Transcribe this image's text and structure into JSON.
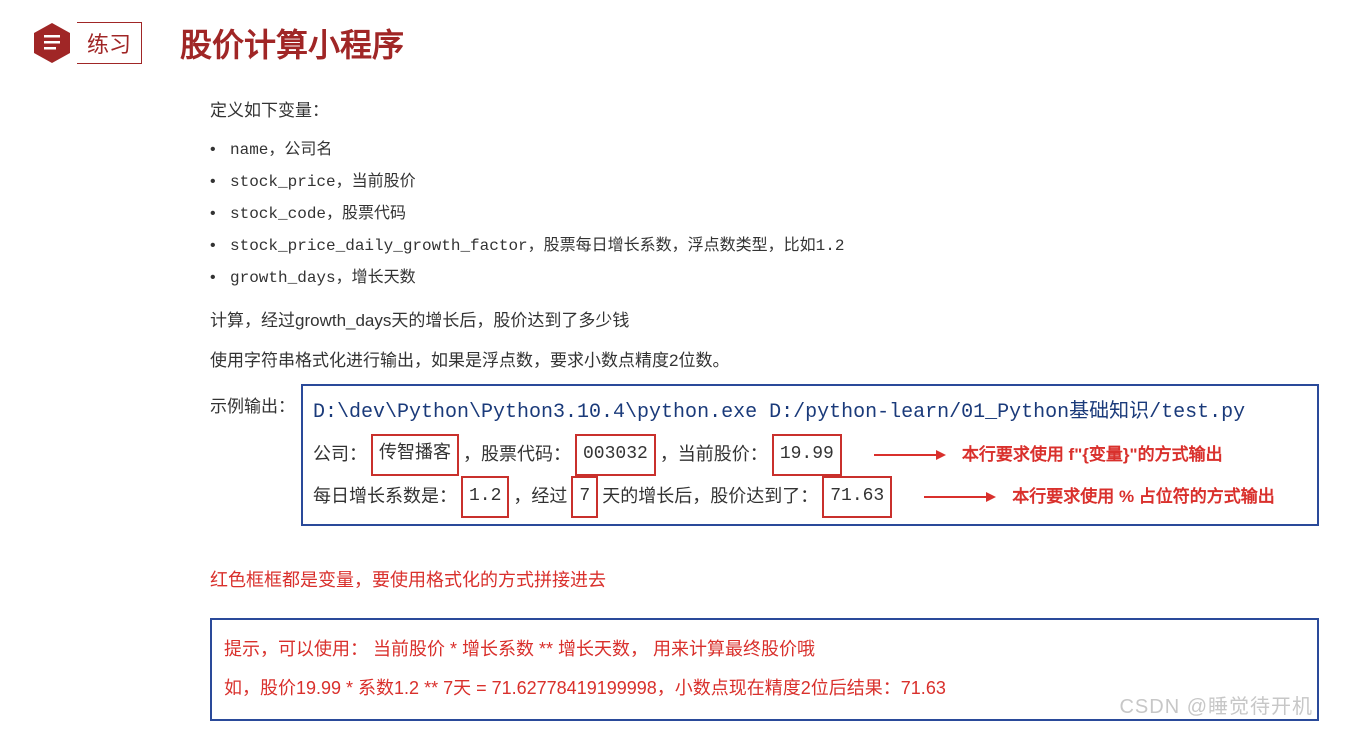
{
  "badge": {
    "label": "练习"
  },
  "title": "股价计算小程序",
  "intro": "定义如下变量：",
  "vars": [
    "name，公司名",
    "stock_price，当前股价",
    "stock_code，股票代码",
    "stock_price_daily_growth_factor，股票每日增长系数，浮点数类型，比如1.2",
    "growth_days，增长天数"
  ],
  "calc_line": "计算，经过growth_days天的增长后，股价达到了多少钱",
  "format_line": "使用字符串格式化进行输出，如果是浮点数，要求小数点精度2位数。",
  "example_label": "示例输出：",
  "output": {
    "path": "D:\\dev\\Python\\Python3.10.4\\python.exe D:/python-learn/01_Python基础知识/test.py",
    "line2": {
      "pre1": "公司：",
      "company": "传智播客",
      "mid1": "，股票代码：",
      "code": "003032",
      "mid2": "，当前股价：",
      "price": "19.99",
      "anno": "本行要求使用 f\"{变量}\"的方式输出"
    },
    "line3": {
      "pre1": "每日增长系数是：",
      "factor": "1.2",
      "mid1": "，经过",
      "days": "7",
      "mid2": "天的增长后，股价达到了：",
      "final": "71.63",
      "anno": "本行要求使用 % 占位符的方式输出"
    }
  },
  "red_note": "红色框框都是变量，要使用格式化的方式拼接进去",
  "hint": {
    "l1": "提示，可以使用：  当前股价 * 增长系数 ** 增长天数， 用来计算最终股价哦",
    "l2": "如，股价19.99 * 系数1.2 ** 7天 = 71.62778419199998，小数点现在精度2位后结果：71.63"
  },
  "watermark": "CSDN @睡觉待开机"
}
